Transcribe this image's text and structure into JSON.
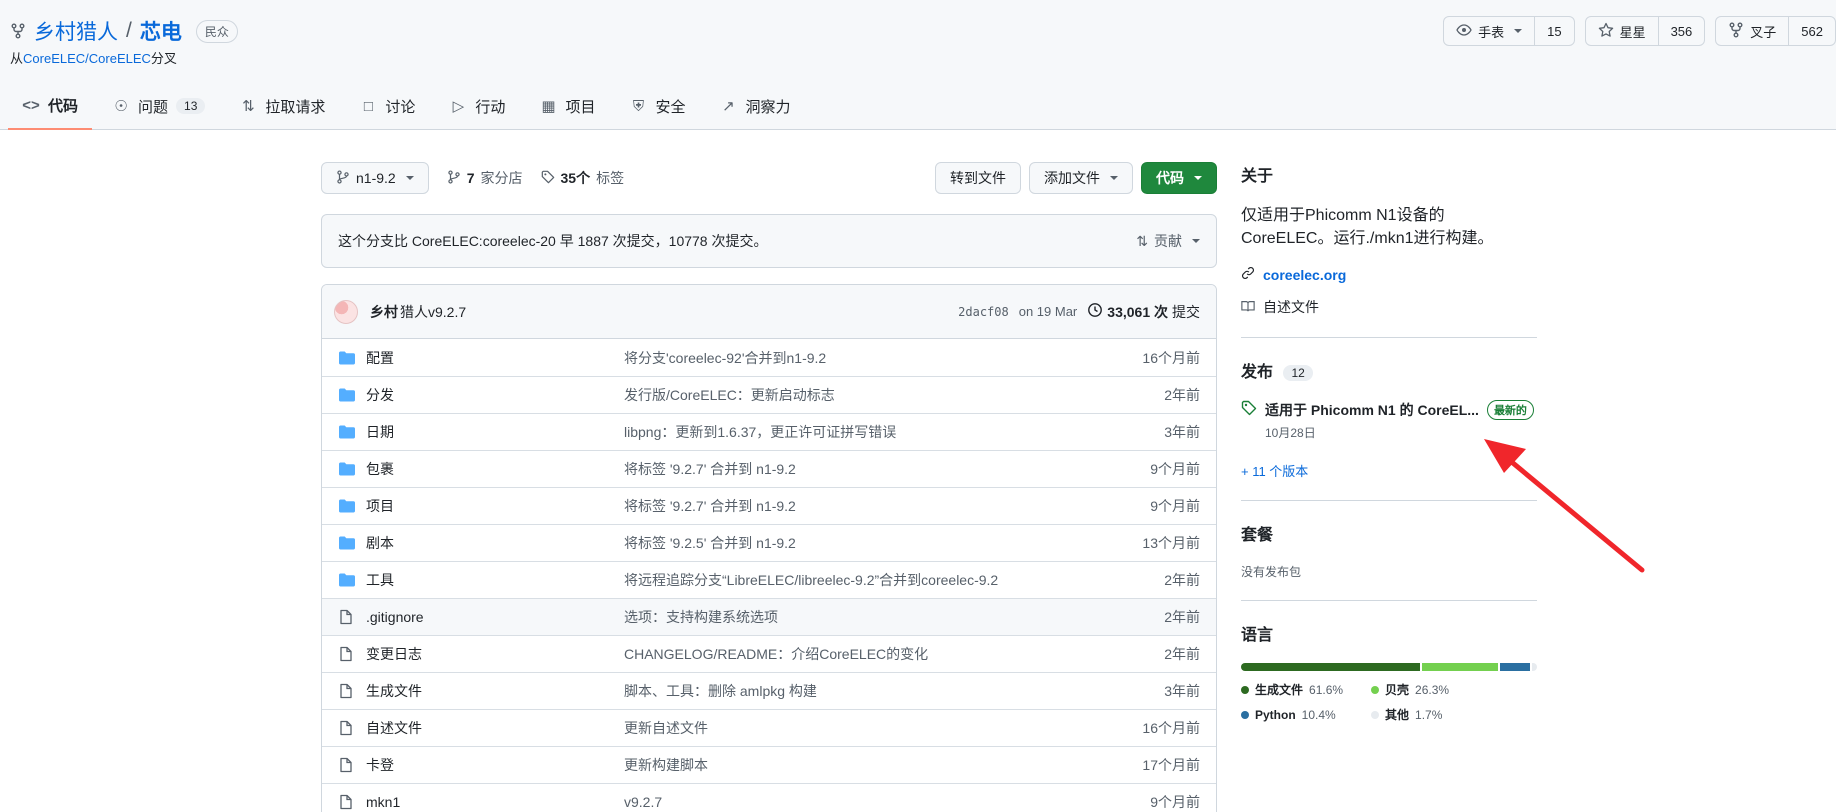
{
  "header": {
    "owner": "乡村猎人",
    "separator": "/",
    "repo": "芯电",
    "visibility": "民众",
    "forked_prefix": "从",
    "forked_from": "CoreELEC/CoreELEC",
    "forked_suffix": "分叉"
  },
  "actions": {
    "watch_label": "手表",
    "watch_count": "15",
    "star_label": "星星",
    "star_count": "356",
    "fork_label": "叉子",
    "fork_count": "562"
  },
  "tabs": [
    {
      "label": "代码",
      "icon": "code-icon"
    },
    {
      "label": "问题",
      "icon": "issue-icon",
      "count": "13"
    },
    {
      "label": "拉取请求",
      "icon": "pull-request-icon"
    },
    {
      "label": "讨论",
      "icon": "discussion-icon"
    },
    {
      "label": "行动",
      "icon": "play-icon"
    },
    {
      "label": "项目",
      "icon": "table-icon"
    },
    {
      "label": "安全",
      "icon": "shield-icon"
    },
    {
      "label": "洞察力",
      "icon": "graph-icon"
    }
  ],
  "toolbar": {
    "branch": "n1-9.2",
    "branches_count": "7",
    "branches_label": "家分店",
    "tags_count": "35个",
    "tags_label": "标签",
    "goto_file": "转到文件",
    "add_file": "添加文件",
    "code": "代码"
  },
  "compare": {
    "text": "这个分支比 CoreELEC:coreelec-20 早 1887 次提交，10778 次提交。",
    "contribute": "贡献"
  },
  "commit": {
    "author": "乡村",
    "message": "猎人v9.2.7",
    "sha": "2dacf08",
    "date": "on 19 Mar",
    "count": "33,061 次",
    "count_label": "提交"
  },
  "files": [
    {
      "name": "配置",
      "type": "dir",
      "message": "将分支'coreelec-92'合并到n1-9.2",
      "age": "16个月前"
    },
    {
      "name": "分发",
      "type": "dir",
      "message": "发行版/CoreELEC：更新启动标志",
      "age": "2年前"
    },
    {
      "name": "日期",
      "type": "dir",
      "message": "libpng：更新到1.6.37，更正许可证拼写错误",
      "age": "3年前"
    },
    {
      "name": "包裹",
      "type": "dir",
      "message": "将标签 '9.2.7' 合并到 n1-9.2",
      "age": "9个月前"
    },
    {
      "name": "项目",
      "type": "dir",
      "message": "将标签 '9.2.7' 合并到 n1-9.2",
      "age": "9个月前"
    },
    {
      "name": "剧本",
      "type": "dir",
      "message": "将标签 '9.2.5' 合并到 n1-9.2",
      "age": "13个月前"
    },
    {
      "name": "工具",
      "type": "dir",
      "message": "将远程追踪分支“LibreELEC/libreelec-9.2”合并到coreelec-9.2",
      "age": "2年前"
    },
    {
      "name": ".gitignore",
      "type": "file",
      "message": "选项：支持构建系统选项",
      "age": "2年前"
    },
    {
      "name": "变更日志",
      "type": "file",
      "message": "CHANGELOG/README：介绍CoreELEC的变化",
      "age": "2年前"
    },
    {
      "name": "生成文件",
      "type": "file",
      "message": "脚本、工具：删除 amlpkg 构建",
      "age": "3年前"
    },
    {
      "name": "自述文件",
      "type": "file",
      "message": "更新自述文件",
      "age": "16个月前"
    },
    {
      "name": "卡登",
      "type": "file",
      "message": "更新构建脚本",
      "age": "17个月前"
    },
    {
      "name": "mkn1",
      "type": "file",
      "message": "v9.2.7",
      "age": "9个月前"
    }
  ],
  "sidebar": {
    "about_title": "关于",
    "description": "仅适用于Phicomm N1设备的CoreELEC。运行./mkn1进行构建。",
    "homepage": "coreelec.org",
    "readme": "自述文件",
    "releases_title": "发布",
    "releases_count": "12",
    "release_name": "适用于 Phicomm N1 的 CoreEL...",
    "latest_badge": "最新的",
    "release_date": "10月28日",
    "more_releases": "+ 11 个版本",
    "packages_title": "套餐",
    "no_packages": "没有发布包",
    "languages_title": "语言",
    "languages": [
      {
        "name": "生成文件",
        "percent": "61.6%",
        "value": 61.6,
        "color": "#2d6a21"
      },
      {
        "name": "贝壳",
        "percent": "26.3%",
        "value": 26.3,
        "color": "#74d04f"
      },
      {
        "name": "Python",
        "percent": "10.4%",
        "value": 10.4,
        "color": "#2a6fa1"
      },
      {
        "name": "其他",
        "percent": "1.7%",
        "value": 1.7,
        "color": "#e7ebef"
      }
    ]
  }
}
